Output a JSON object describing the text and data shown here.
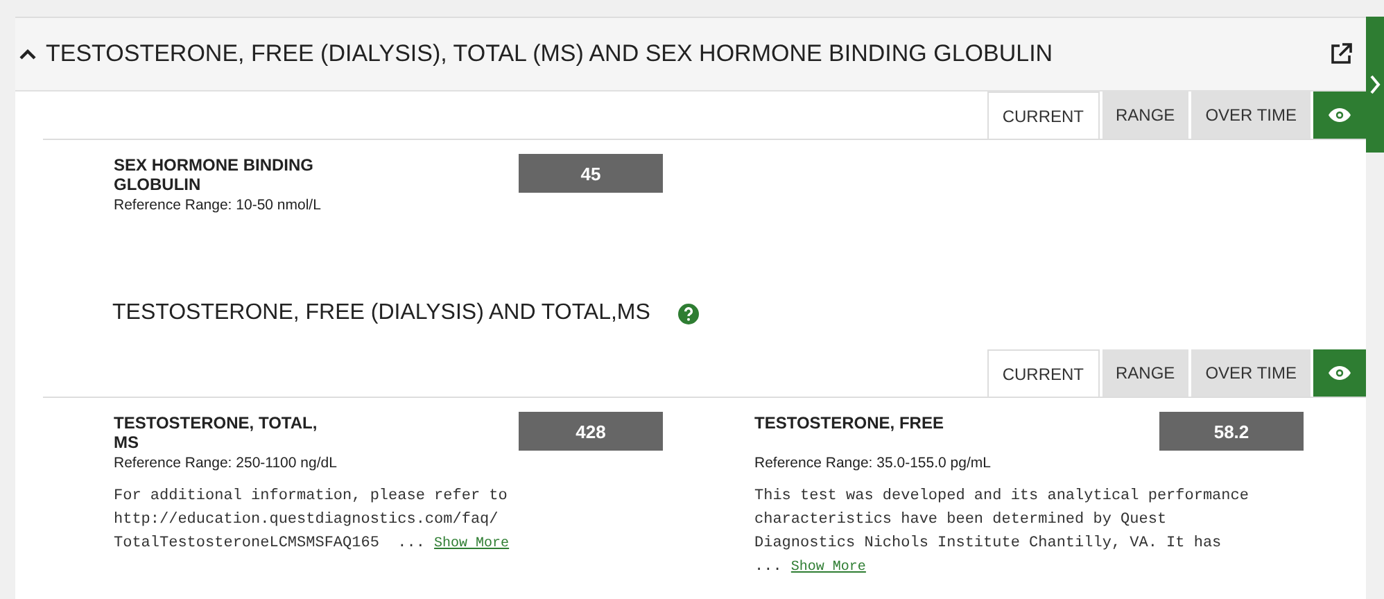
{
  "panel": {
    "title": "TESTOSTERONE, FREE (DIALYSIS), TOTAL (MS) AND SEX HORMONE BINDING GLOBULIN",
    "expanded": true
  },
  "sections": [
    {
      "tabs": [
        {
          "label": "CURRENT",
          "selected": true
        },
        {
          "label": "RANGE",
          "selected": false
        },
        {
          "label": "OVER TIME",
          "selected": false
        }
      ],
      "results": [
        {
          "name": "SEX HORMONE BINDING\nGLOBULIN",
          "reference": "Reference Range: 10-50 nmol/L",
          "value": "45"
        }
      ]
    },
    {
      "title": "TESTOSTERONE, FREE (DIALYSIS) AND TOTAL,MS",
      "tabs": [
        {
          "label": "CURRENT",
          "selected": true
        },
        {
          "label": "RANGE",
          "selected": false
        },
        {
          "label": "OVER TIME",
          "selected": false
        }
      ],
      "results": [
        {
          "name": "TESTOSTERONE, TOTAL,\nMS",
          "reference": "Reference Range: 250-1100 ng/dL",
          "value": "428",
          "note": "For additional information, please refer to\nhttp://education.questdiagnostics.com/faq/\nTotalTestosteroneLCMSMSFAQ165  ...",
          "link": "Show More"
        },
        {
          "name": "TESTOSTERONE, FREE",
          "reference": "Reference Range: 35.0-155.0 pg/mL",
          "value": "58.2",
          "note": "This test was developed and its analytical performance\ncharacteristics have been determined by Quest\nDiagnostics Nichols Institute Chantilly, VA. It has\n...",
          "link": "Show More"
        }
      ]
    }
  ]
}
